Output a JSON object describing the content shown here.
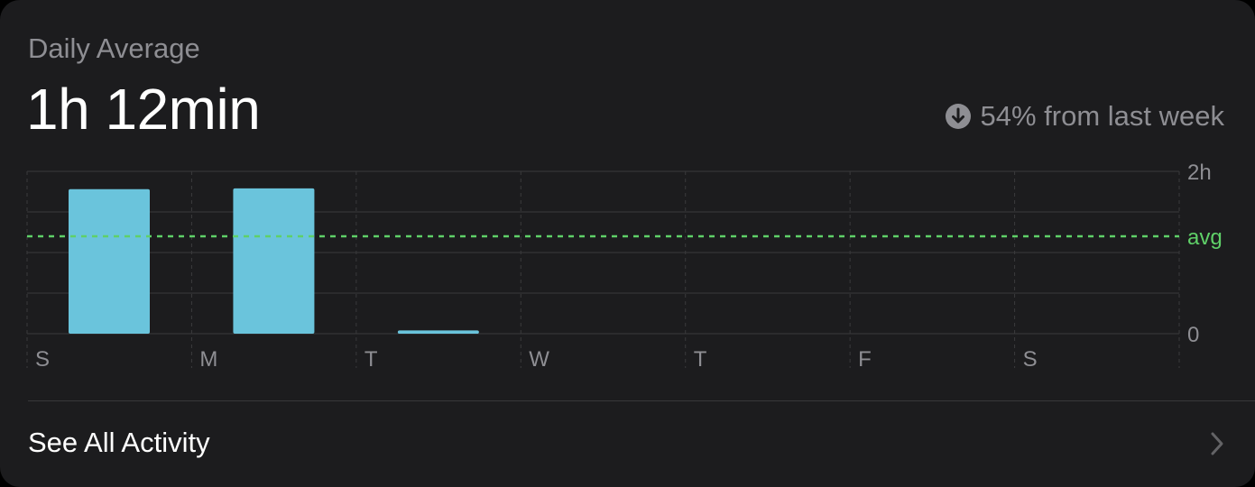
{
  "card": {
    "title": "Daily Average",
    "value": "1h 12min",
    "change": {
      "text": "54% from last week",
      "direction": "down",
      "icon": "arrow-down-circle-icon"
    }
  },
  "chart_data": {
    "type": "bar",
    "categories": [
      "S",
      "M",
      "T",
      "W",
      "T",
      "F",
      "S"
    ],
    "values": [
      1.78,
      1.79,
      0.04,
      0,
      0,
      0,
      0
    ],
    "ylim": [
      0,
      2
    ],
    "y_tick_labels": [
      "2h",
      "0"
    ],
    "average": {
      "label": "avg",
      "value": 1.2
    },
    "grid": true,
    "colors": {
      "bar": "#6ac4dc",
      "average": "#5fd068",
      "grid": "#3a3a3c",
      "tick": "#8e8e93"
    }
  },
  "footer": {
    "see_all_label": "See All Activity",
    "chevron_icon": "chevron-right-icon"
  }
}
